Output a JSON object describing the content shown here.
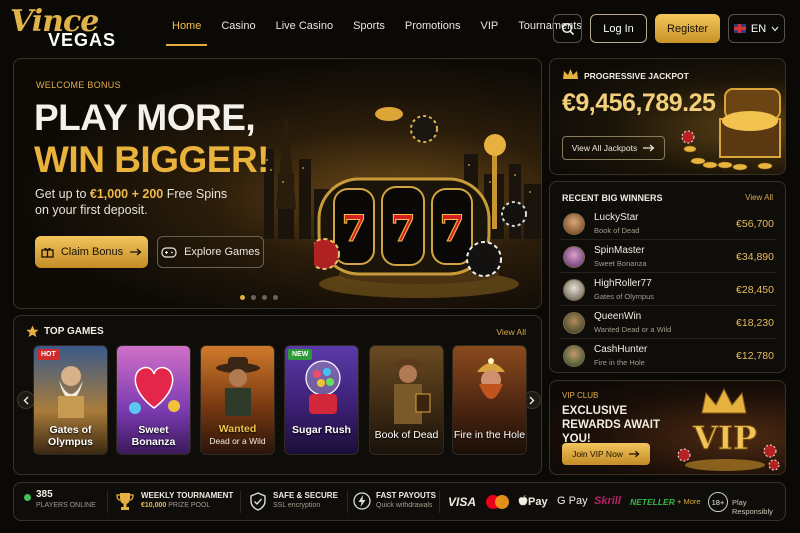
{
  "brand": {
    "script": "Vince",
    "word": "VEGAS"
  },
  "nav": {
    "items": [
      "Home",
      "Casino",
      "Live Casino",
      "Sports",
      "Promotions",
      "VIP",
      "Tournaments"
    ],
    "active": "Home"
  },
  "header": {
    "login": "Log In",
    "register": "Register",
    "language": "EN"
  },
  "hero": {
    "eyebrow": "WELCOME BONUS",
    "title_line1": "PLAY MORE,",
    "title_line2": "WIN BIGGER!",
    "sub_prefix": "Get up to ",
    "sub_highlight": "€1,000 + 200",
    "sub_suffix": " Free Spins on your first deposit.",
    "claim": "Claim Bonus",
    "explore": "Explore Games",
    "slides": 4,
    "active_slide": 1
  },
  "jackpot": {
    "title": "PROGRESSIVE JACKPOT",
    "amount": "€9,456,789.25",
    "button": "View All Jackpots"
  },
  "winners": {
    "title": "RECENT BIG WINNERS",
    "view_all": "View All",
    "rows": [
      {
        "name": "LuckyStar",
        "game": "Book of Dead",
        "amount": "€56,700"
      },
      {
        "name": "SpinMaster",
        "game": "Sweet Bonanza",
        "amount": "€34,890"
      },
      {
        "name": "HighRoller77",
        "game": "Gates of Olympus",
        "amount": "€28,450"
      },
      {
        "name": "QueenWin",
        "game": "Wanted Dead or a Wild",
        "amount": "€18,230"
      },
      {
        "name": "CashHunter",
        "game": "Fire in the Hole",
        "amount": "€12,780"
      }
    ]
  },
  "vip": {
    "eyebrow": "VIP CLUB",
    "title": "EXCLUSIVE REWARDS AWAIT YOU!",
    "button": "Join VIP Now",
    "art_text": "VIP"
  },
  "top_games": {
    "title": "TOP GAMES",
    "view_all": "View All",
    "cards": [
      {
        "title": "Gates of Olympus",
        "sub": "",
        "badge": "HOT"
      },
      {
        "title": "Sweet Bonanza",
        "sub": "",
        "badge": ""
      },
      {
        "title": "Wanted",
        "sub": "Dead or a Wild",
        "badge": ""
      },
      {
        "title": "Sugar Rush",
        "sub": "",
        "badge": "NEW"
      },
      {
        "title": "Book of Dead",
        "sub": "",
        "badge": ""
      },
      {
        "title": "Fire in the Hole",
        "sub": "",
        "badge": ""
      }
    ]
  },
  "footer": {
    "players_count": "385",
    "players_label": "PLAYERS ONLINE",
    "tournament_title": "WEEKLY TOURNAMENT",
    "tournament_prize": "€10,000",
    "tournament_prize_label": "PRIZE POOL",
    "secure_title": "SAFE & SECURE",
    "secure_sub": "SSL encryption",
    "payout_title": "FAST PAYOUTS",
    "payout_sub": "Quick withdrawals",
    "payments": [
      "VISA",
      "Mastercard",
      "Pay",
      "G Pay",
      "Skrill",
      "NETELLER"
    ],
    "more": "+ More",
    "age": "18+",
    "responsible": "Play Responsibly"
  },
  "colors": {
    "gold": "#e2ad3d",
    "bg": "#0a0906",
    "online": "#3fc15a"
  }
}
